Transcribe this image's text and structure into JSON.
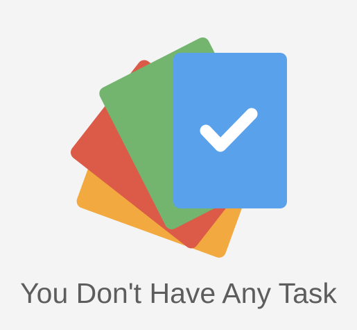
{
  "empty_state": {
    "message": "You Don't Have Any Task",
    "icon": "checkmark-icon"
  },
  "colors": {
    "background": "#f4f4f4",
    "card_orange": "#f2a93f",
    "card_red": "#db5a48",
    "card_green": "#73b56f",
    "card_blue": "#5aa1ec",
    "checkmark": "#ffffff",
    "message_text": "#5d5d5d"
  }
}
